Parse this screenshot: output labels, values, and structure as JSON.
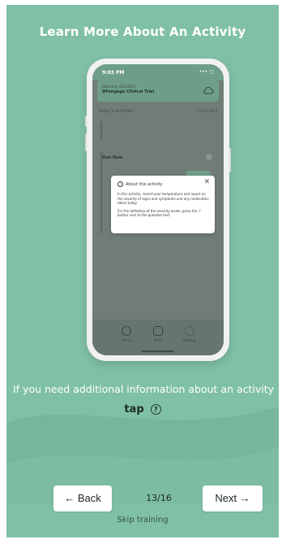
{
  "header": {
    "title": "Learn More About An Activity"
  },
  "phone_preview": {
    "status_time": "9:03 PM",
    "status_icons": "••• ▢",
    "welcome_text": "Welcome, 45112023",
    "study_name": "DFengage Clinical Trial",
    "section_title": "Today's Activities",
    "section_date": "12 Apr 2024",
    "due_now_label": "Due Now",
    "popup": {
      "title": "About this activity",
      "close_symbol": "✕",
      "paragraph_1": "In this activity, record your temperature and report on the severity of signs and symptoms and any medication taken today.",
      "paragraph_2": "For the definition of the severity levels, press the 'i' button next to the question text."
    },
    "tabs": [
      {
        "label": "Status"
      },
      {
        "label": "Today"
      },
      {
        "label": "Settings"
      }
    ]
  },
  "info": {
    "text": "If you need additional information about an activity",
    "tap_word": "tap",
    "help_glyph": "?"
  },
  "navigation": {
    "back_label": "← Back",
    "next_label": "Next →",
    "page_counter": "13/16",
    "skip_label": "Skip training"
  },
  "colors": {
    "background": "#7fc0a6",
    "button_bg": "#ffffff",
    "text_light": "#ffffff"
  }
}
